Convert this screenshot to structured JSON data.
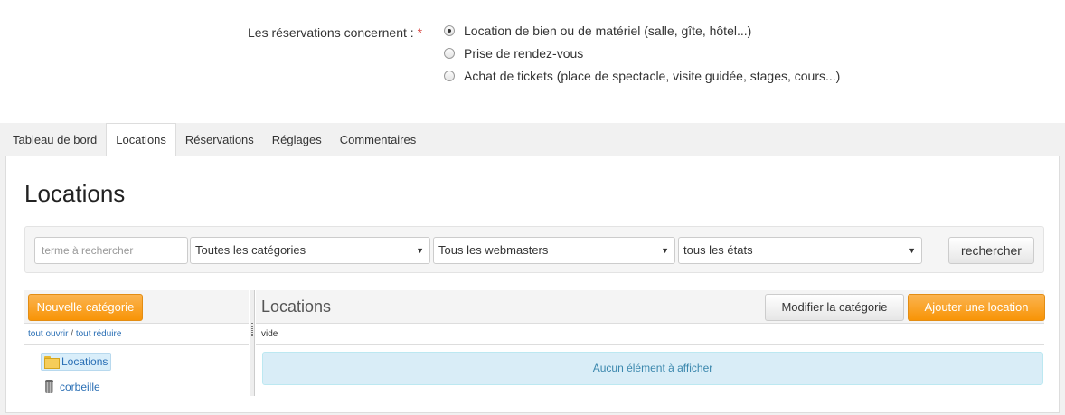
{
  "reservations": {
    "label": "Les réservations concernent :",
    "required_mark": "*",
    "options": [
      {
        "label": "Location de bien ou de matériel (salle, gîte, hôtel...)",
        "checked": true
      },
      {
        "label": "Prise de rendez-vous",
        "checked": false
      },
      {
        "label": "Achat de tickets (place de spectacle, visite guidée, stages, cours...)",
        "checked": false
      }
    ]
  },
  "tabs": [
    {
      "label": "Tableau de bord",
      "active": false
    },
    {
      "label": "Locations",
      "active": true
    },
    {
      "label": "Réservations",
      "active": false
    },
    {
      "label": "Réglages",
      "active": false
    },
    {
      "label": "Commentaires",
      "active": false
    }
  ],
  "page": {
    "title": "Locations"
  },
  "filters": {
    "search_placeholder": "terme à rechercher",
    "category_select": "Toutes les catégories",
    "webmaster_select": "Tous les webmasters",
    "state_select": "tous les états",
    "search_button": "rechercher"
  },
  "tree": {
    "new_category_button": "Nouvelle catégorie",
    "open_all": "tout ouvrir",
    "separator": "/",
    "collapse_all": "tout réduire",
    "items": [
      {
        "label": "Locations",
        "icon": "folder-open-icon",
        "selected": true
      },
      {
        "label": "corbeille",
        "icon": "trash-icon",
        "selected": false
      }
    ]
  },
  "content": {
    "title": "Locations",
    "edit_category_button": "Modifier la catégorie",
    "add_location_button": "Ajouter une location",
    "path": "vide",
    "empty_message": "Aucun élément à afficher"
  },
  "colors": {
    "accent_orange": "#f89406",
    "link_blue": "#2a6fb5",
    "info_bg": "#d9edf7",
    "required_red": "#d9534f"
  }
}
